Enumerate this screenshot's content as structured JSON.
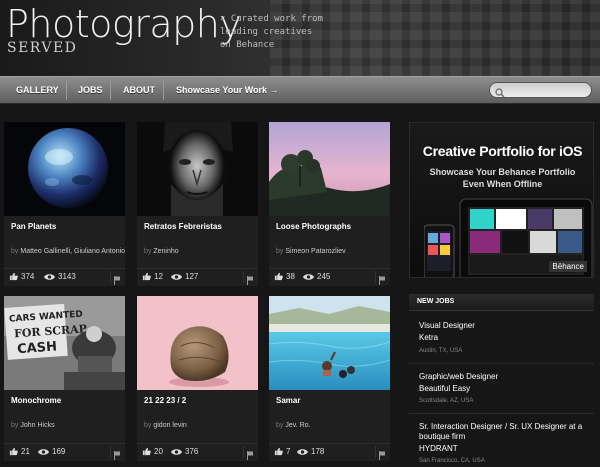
{
  "header": {
    "title": "Photography",
    "subtitle": "SERVED",
    "tagline_line1": "× Curated work from",
    "tagline_line2": "leading creatives",
    "tagline_line3": "on Behance"
  },
  "nav": {
    "items": [
      {
        "label": "GALLERY"
      },
      {
        "label": "JOBS"
      },
      {
        "label": "ABOUT"
      },
      {
        "label": "Showcase Your Work →"
      }
    ],
    "search_placeholder": ""
  },
  "cards": [
    {
      "title": "Pan Planets",
      "by": "by",
      "author": "Matteo Gallinelli, Giuliano Antonio",
      "likes": "374",
      "views": "3143"
    },
    {
      "title": "Retratos Febreristas",
      "by": "by",
      "author": "Zeninho",
      "likes": "12",
      "views": "127"
    },
    {
      "title": "Loose Photographs",
      "by": "by",
      "author": "Simeon Patarozliev",
      "likes": "38",
      "views": "245"
    },
    {
      "title": "Monochrome",
      "by": "by",
      "author": "John Hicks",
      "likes": "21",
      "views": "169"
    },
    {
      "title": "21 22 23 / 2",
      "by": "by",
      "author": "gidon levin",
      "likes": "20",
      "views": "376"
    },
    {
      "title": "Samar",
      "by": "by",
      "author": "Jev. Ro.",
      "likes": "7",
      "views": "178"
    }
  ],
  "ad": {
    "title": "Creative Portfolio for iOS",
    "line1": "Showcase Your Behance Portfolio",
    "line2": "Even When Offline",
    "logo": "Bēhance"
  },
  "jobs": {
    "heading": "NEW JOBS",
    "items": [
      {
        "title": "Visual Designer",
        "company": "Ketra",
        "location": "Austin, TX, USA"
      },
      {
        "title": "Graphic/web Designer",
        "company": "Beautiful Easy",
        "location": "Scottsdale, AZ, USA"
      },
      {
        "title": "Sr. Interaction Designer / Sr. UX Designer at a boutique firm",
        "company": "HYDRANT",
        "location": "San Francisco, CA, USA"
      }
    ]
  },
  "colors": {
    "accent": "#ffffff",
    "nav_top": "#8e8e8e",
    "nav_bottom": "#5f5f5f"
  }
}
